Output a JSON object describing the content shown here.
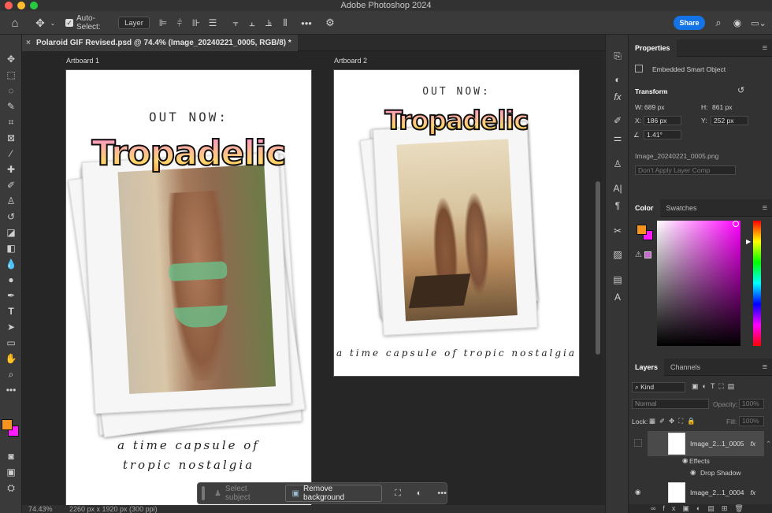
{
  "app": {
    "title": "Adobe Photoshop 2024"
  },
  "options": {
    "auto_select_label": "Auto-Select:",
    "auto_select_value": "Layer",
    "share_label": "Share"
  },
  "document": {
    "tab_title": "Polaroid GIF Revised.psd @ 74.4% (Image_20240221_0005, RGB/8) *"
  },
  "artboards": [
    {
      "label": "Artboard 1",
      "headline": "OUT NOW:",
      "title": "Tropadelic",
      "tagline_1": "a time capsule of",
      "tagline_2": "tropic nostalgia"
    },
    {
      "label": "Artboard 2",
      "headline": "OUT NOW:",
      "title": "Tropadelic",
      "tagline_1": "a time capsule of tropic nostalgia"
    }
  ],
  "contextual_bar": {
    "select_subject": "Select subject",
    "remove_background": "Remove background"
  },
  "status": {
    "zoom": "74.43%",
    "doc_size": "2260 px x 1920 px (300 ppi)"
  },
  "properties": {
    "title": "Properties",
    "object_type": "Embedded Smart Object",
    "transform_label": "Transform",
    "w_label": "W:",
    "w_value": "689 px",
    "h_label": "H:",
    "h_value": "861 px",
    "x_label": "X:",
    "x_value": "186 px",
    "y_label": "Y:",
    "y_value": "252 px",
    "angle_value": "1.41°",
    "file_name": "Image_20240221_0005.png",
    "layer_comp": "Don't Apply Layer Comp"
  },
  "color_panel": {
    "tab_color": "Color",
    "tab_swatches": "Swatches",
    "foreground": "#f7941d",
    "background": "#ff1aff"
  },
  "layers_panel": {
    "tab_layers": "Layers",
    "tab_channels": "Channels",
    "filter_kind": "Kind",
    "blend_mode": "Normal",
    "opacity_label": "Opacity:",
    "opacity_value": "100%",
    "lock_label": "Lock:",
    "fill_label": "Fill:",
    "fill_value": "100%",
    "layers": [
      {
        "name": "Image_2...1_0005",
        "fx": "fx",
        "effects_label": "Effects",
        "effect": "Drop Shadow"
      },
      {
        "name": "Image_2...1_0004",
        "fx": "fx"
      }
    ]
  }
}
